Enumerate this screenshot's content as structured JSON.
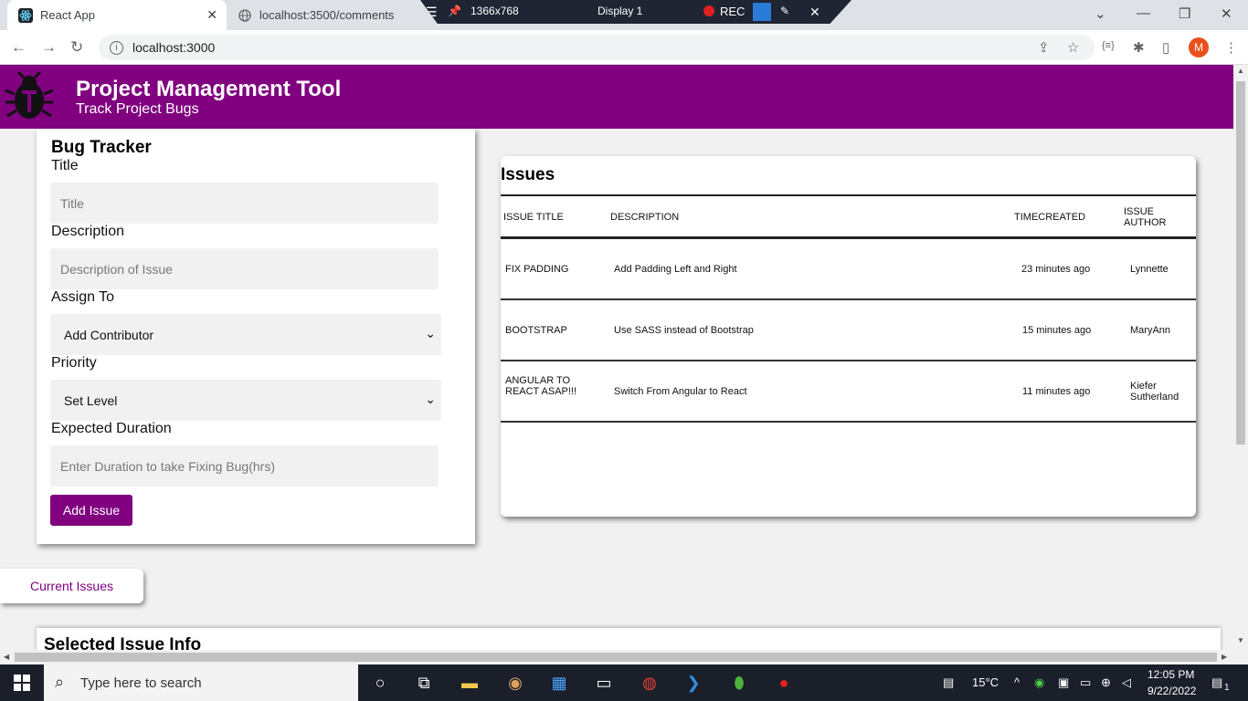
{
  "browser": {
    "tabs": [
      {
        "label": "React App"
      },
      {
        "label": "localhost:3500/comments"
      }
    ],
    "recorder": {
      "resolution": "1366x768",
      "display": "Display 1",
      "rec": "REC"
    },
    "address": "localhost:3000",
    "profile_initial": "M"
  },
  "app": {
    "title": "Project Management Tool",
    "subtitle": "Track Project Bugs",
    "form": {
      "heading": "Bug Tracker",
      "title_label": "Title",
      "title_placeholder": "Title",
      "description_label": "Description",
      "description_placeholder": "Description of Issue",
      "assign_label": "Assign To",
      "assign_value": "Add Contributor",
      "priority_label": "Priority",
      "priority_value": "Set Level",
      "duration_label": "Expected Duration",
      "duration_placeholder": "Enter Duration to take Fixing Bug(hrs)",
      "submit_label": "Add Issue"
    },
    "issues": {
      "heading": "Issues",
      "columns": [
        "ISSUE TITLE",
        "DESCRIPTION",
        "TIMECREATED",
        "ISSUE AUTHOR"
      ],
      "rows": [
        {
          "title": "FIX PADDING",
          "description": "Add Padding Left and Right",
          "time": "23 minutes ago",
          "author": "Lynnette"
        },
        {
          "title": "BOOTSTRAP",
          "description": "Use SASS instead of Bootstrap",
          "time": "15 minutes ago",
          "author": "MaryAnn"
        },
        {
          "title": "ANGULAR TO REACT ASAP!!!",
          "description": "Switch From Angular to React",
          "time": "11 minutes ago",
          "author": "Kiefer Sutherland"
        }
      ]
    },
    "current_issues_label": "Current Issues",
    "selected_heading": "Selected Issue Info"
  },
  "taskbar": {
    "search_placeholder": "Type here to search",
    "temperature": "15°C",
    "time": "12:05 PM",
    "date": "9/22/2022",
    "notifications": "1"
  }
}
